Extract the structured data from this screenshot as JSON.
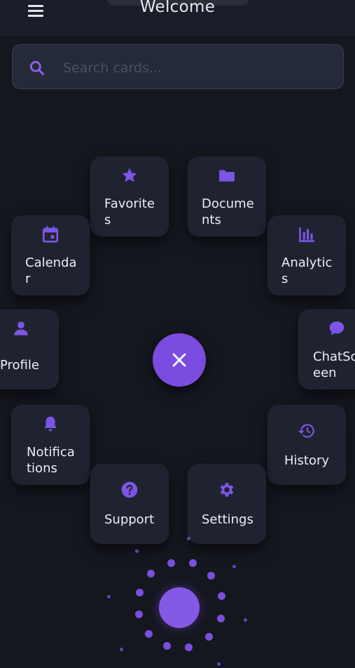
{
  "app": {
    "title": "Welcome"
  },
  "search": {
    "placeholder": "Search cards..."
  },
  "cards": {
    "favorites": {
      "label": "Favorite\ns",
      "icon": "star-icon"
    },
    "documents": {
      "label": "Docume\nnts",
      "icon": "folder-icon"
    },
    "calendar": {
      "label": "Calenda\nr",
      "icon": "calendar-icon"
    },
    "analytics": {
      "label": "Analytic\ns",
      "icon": "bar-chart-icon"
    },
    "profile": {
      "label": "Profile",
      "icon": "person-icon"
    },
    "chatscreen": {
      "label": "ChatScr\neen",
      "icon": "chat-bubble-icon"
    },
    "notifications": {
      "label": "Notifica\ntions",
      "icon": "bell-icon"
    },
    "history": {
      "label": "History",
      "icon": "history-icon"
    },
    "support": {
      "label": "Support",
      "icon": "help-circle-icon"
    },
    "settings": {
      "label": "Settings",
      "icon": "gear-icon"
    }
  },
  "fab": {
    "icon": "close-icon"
  },
  "colors": {
    "accent": "#7c4ce0",
    "background": "#15171f",
    "card": "#1f2330"
  }
}
